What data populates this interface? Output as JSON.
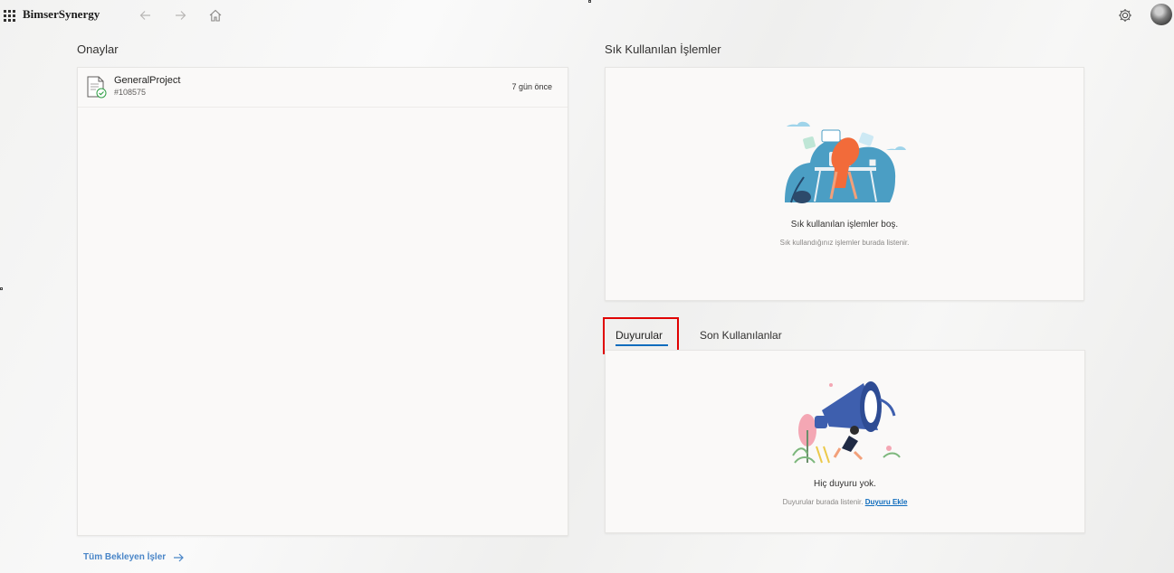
{
  "app": {
    "brand": "BimserSynergy"
  },
  "approvals": {
    "title": "Onaylar",
    "items": [
      {
        "title": "GeneralProject",
        "id": "#108575",
        "time": "7 gün önce"
      }
    ],
    "all_link": "Tüm Bekleyen İşler"
  },
  "frequent": {
    "title": "Sık Kullanılan İşlemler",
    "empty_title": "Sık kullanılan işlemler boş.",
    "empty_sub": "Sık kullandığınız işlemler burada listenir."
  },
  "tabs": [
    {
      "label": "Duyurular",
      "active": true
    },
    {
      "label": "Son Kullanılanlar",
      "active": false
    }
  ],
  "announcements": {
    "empty_title": "Hiç duyuru yok.",
    "empty_sub": "Duyurular burada listenir.",
    "add_link": "Duyuru Ekle"
  },
  "colors": {
    "accent": "#0f6cbd",
    "highlight": "#e00000",
    "link": "#4a86c8"
  }
}
